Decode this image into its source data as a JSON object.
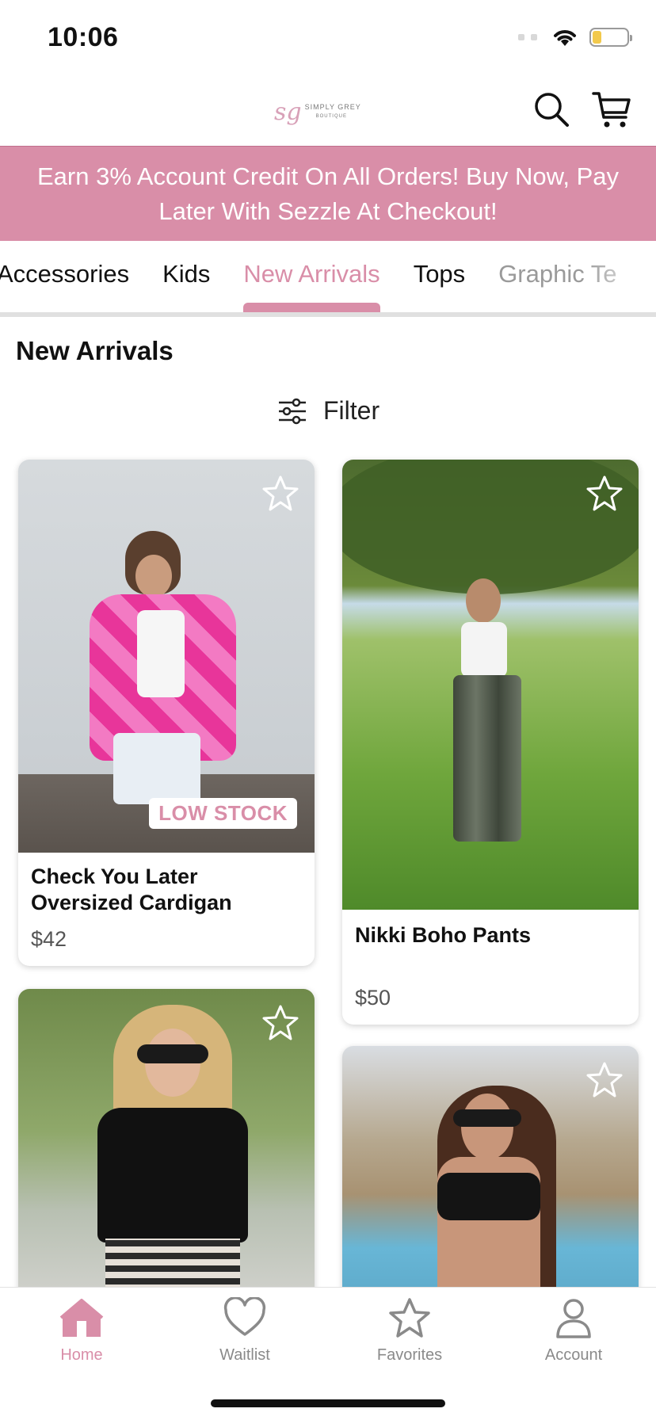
{
  "status_bar": {
    "time": "10:06",
    "battery_fraction": 0.25
  },
  "header": {
    "logo_mark": "sg",
    "logo_text": "SIMPLY GREY",
    "logo_subtext": "BOUTIQUE",
    "search_icon": "search-icon",
    "cart_icon": "cart-icon"
  },
  "promo": {
    "text": "Earn 3% Account Credit On All Orders! Buy Now, Pay Later With Sezzle At Checkout!"
  },
  "tabs": [
    {
      "label": "Accessories",
      "active": false
    },
    {
      "label": "Kids",
      "active": false
    },
    {
      "label": "New Arrivals",
      "active": true
    },
    {
      "label": "Tops",
      "active": false
    },
    {
      "label": "Graphic Te",
      "active": false
    }
  ],
  "section": {
    "title": "New Arrivals",
    "filter_label": "Filter"
  },
  "products": [
    {
      "name": "Check You Later Oversized Cardigan",
      "price": "$42",
      "badge": "LOW STOCK"
    },
    {
      "name": "Nikki Boho Pants",
      "price": "$50",
      "badge": ""
    },
    {
      "name": "",
      "price": "",
      "badge": ""
    },
    {
      "name": "",
      "price": "",
      "badge": ""
    }
  ],
  "bottom_nav": [
    {
      "label": "Home",
      "icon": "home-icon",
      "active": true
    },
    {
      "label": "Waitlist",
      "icon": "heart-icon",
      "active": false
    },
    {
      "label": "Favorites",
      "icon": "star-icon",
      "active": false
    },
    {
      "label": "Account",
      "icon": "person-icon",
      "active": false
    }
  ],
  "colors": {
    "brand_pink": "#d98ea8",
    "text_dark": "#111111",
    "text_muted": "#8a8a8a"
  }
}
